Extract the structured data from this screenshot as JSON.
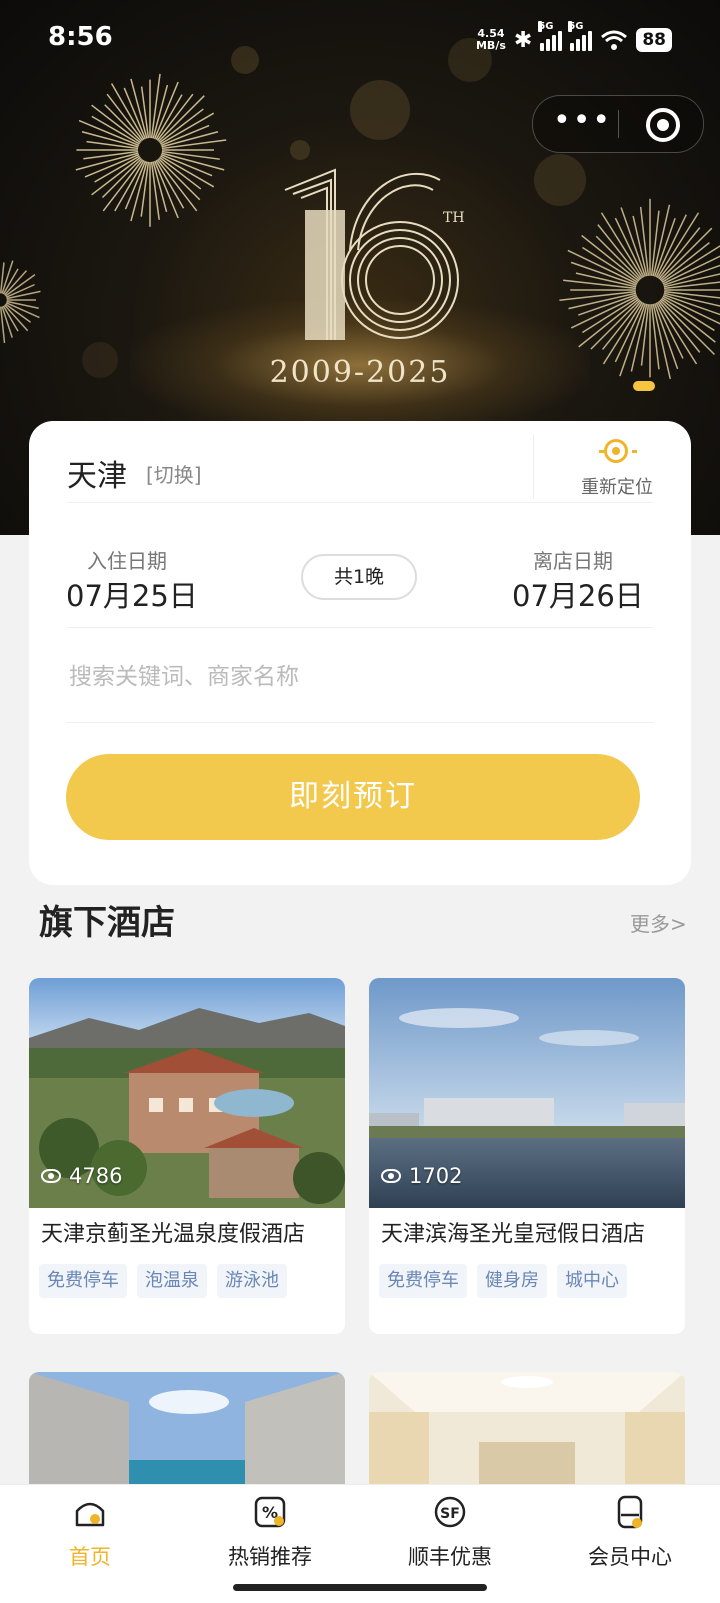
{
  "status_bar": {
    "time": "8:56",
    "net_speed_value": "4.54",
    "net_speed_unit": "MB/s",
    "sim1_label": "5G",
    "sim2_label": "5G",
    "battery": "88"
  },
  "banner": {
    "anniversary_number": "16",
    "anniversary_suffix": "TH",
    "years": "2009-2025",
    "slide_count": 1,
    "active_slide": 1
  },
  "booking": {
    "city": "天津",
    "switch_label": "[切换]",
    "relocate_label": "重新定位",
    "checkin_label": "入住日期",
    "checkin_value": "07月25日",
    "nights_label": "共1晚",
    "checkout_label": "离店日期",
    "checkout_value": "07月26日",
    "search_placeholder": "搜索关键词、商家名称",
    "book_button": "即刻预订"
  },
  "hotels_section": {
    "title": "旗下酒店",
    "more": "更多>",
    "hotels": [
      {
        "name": "天津京蓟圣光温泉度假酒店",
        "views": "4786",
        "tags": [
          "免费停车",
          "泡温泉",
          "游泳池"
        ]
      },
      {
        "name": "天津滨海圣光皇冠假日酒店",
        "views": "1702",
        "tags": [
          "免费停车",
          "健身房",
          "城中心"
        ]
      }
    ]
  },
  "tabbar": {
    "tabs": [
      {
        "label": "首页",
        "icon": "home-icon",
        "active": true
      },
      {
        "label": "热销推荐",
        "icon": "discount-icon",
        "active": false
      },
      {
        "label": "顺丰优惠",
        "icon": "sf-logo-icon",
        "active": false
      },
      {
        "label": "会员中心",
        "icon": "member-card-icon",
        "active": false
      }
    ]
  },
  "colors": {
    "accent": "#f2c94c",
    "active_tab": "#f0b429",
    "tag_text": "#6a87b5",
    "tag_bg": "#f1f4f9"
  }
}
